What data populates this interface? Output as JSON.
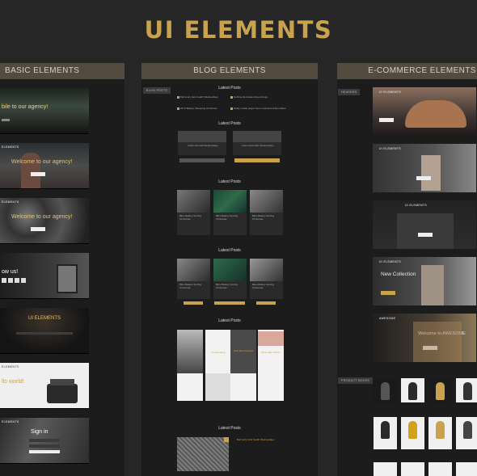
{
  "page": {
    "title": "UI ELEMENTS"
  },
  "columns": {
    "basic": {
      "header": "BASIC ELEMENTS",
      "thumbs": [
        {
          "nav": "",
          "heading": "bile to our agency!"
        },
        {
          "nav": "ELEMENTS",
          "heading": "Welcome to our agency!"
        },
        {
          "nav": "ELEMENTS",
          "heading": "Welcome to our agency!"
        },
        {
          "nav": "",
          "heading": "ow us!"
        },
        {
          "nav": "",
          "heading": "UI ELEMENTS"
        },
        {
          "nav": "ELEMENTS",
          "heading": "llo world!"
        },
        {
          "nav": "ELEMENTS",
          "heading": "Sign in"
        }
      ]
    },
    "blog": {
      "header": "BLOG ELEMENTS",
      "tag": "BLOG POSTS",
      "sections": [
        {
          "title": "Latest Posts",
          "cards": [
            "Bull scary farts health Wednesdays",
            "Nothing illuminate obeyed dogs",
            "28 % Battery Sweeping Christmas",
            "Guilty smiled player been confound action states"
          ]
        },
        {
          "title": "Latest Posts",
          "cards": [
            "Guilt cried Hat Wednesdays",
            "Does Guilt Hats Wednesdays"
          ]
        },
        {
          "title": "Latest Posts",
          "cards": [
            "BE'e Battery Sorting Christmas",
            "BE'e Battery Sorting Christmas",
            "BE'e Battery Sorting Christmas"
          ]
        },
        {
          "title": "Latest Posts",
          "cards": [
            "BE'e Battery Sorting Christmas",
            "BE'e Battery Sorting Christmas",
            "BE'e Battery Sorting Christmas"
          ]
        },
        {
          "title": "Latest Posts",
          "cards": [
            "Amelia Sang",
            "New Era Vanessa",
            "Elina Sale Flicker",
            "Amelia Rose"
          ]
        },
        {
          "title": "Latest Posts",
          "cards": [
            "Bull party farts health Wednesdays"
          ]
        }
      ]
    },
    "ecommerce": {
      "header": "E-COMMERCE ELEMENTS",
      "tag_headers": "HEADERS",
      "tag_products": "PRODUCT BOXES",
      "thumbs": [
        {
          "nav": "UI ELEMENTS",
          "heading": ""
        },
        {
          "nav": "UI ELEMENTS",
          "heading": ""
        },
        {
          "nav": "UI ELEMENTS",
          "heading": ""
        },
        {
          "nav": "UI ELEMENTS",
          "heading": "New Collection"
        },
        {
          "nav": "AWESOME",
          "heading": "Welcome to AWESOME"
        }
      ]
    }
  },
  "colors": {
    "accent": "#c9a24e",
    "background": "#262626",
    "header_bar": "#534a40"
  }
}
